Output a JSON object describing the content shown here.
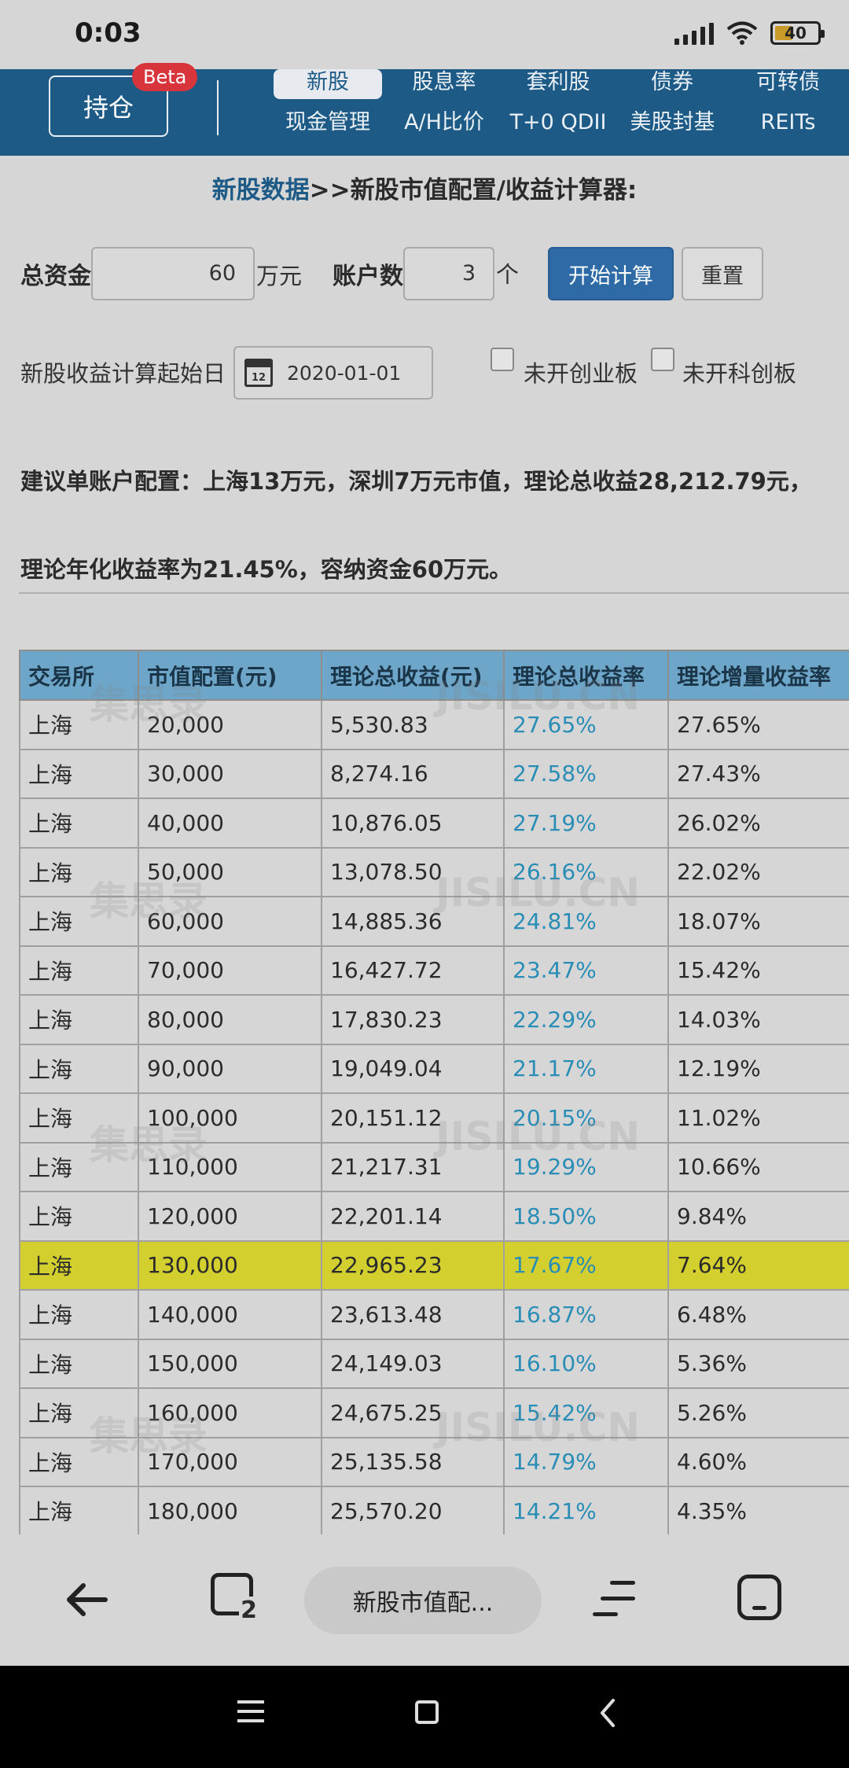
{
  "status": {
    "time": "0:03",
    "battery": "40"
  },
  "nav": {
    "holdings": "持仓",
    "beta": "Beta",
    "row1": [
      "新股",
      "股息率",
      "套利股",
      "债券",
      "可转债"
    ],
    "row2": [
      "现金管理",
      "A/H比价",
      "T+0 QDII",
      "美股封基",
      "REITs"
    ]
  },
  "title": {
    "link": "新股数据",
    "rest": ">>新股市值配置/收益计算器:"
  },
  "form": {
    "capital_label": "总资金",
    "capital_value": "60",
    "capital_unit": "万元",
    "accounts_label": "账户数",
    "accounts_value": "3",
    "accounts_unit": "个",
    "calc_button": "开始计算",
    "reset_button": "重置",
    "start_date_label": "新股收益计算起始日",
    "start_date_value": "2020-01-01",
    "calendar_day": "12",
    "chinext_label": "未开创业板",
    "star_label": "未开科创板"
  },
  "suggestion": "建议单账户配置：上海13万元，深圳7万元市值，理论总收益28,212.79元，理论年化收益率为21.45%，容纳资金60万元。",
  "table": {
    "headers": [
      "交易所",
      "市值配置(元)",
      "理论总收益(元)",
      "理论总收益率",
      "理论增量收益率"
    ],
    "highlight_row": 11,
    "rows": [
      [
        "上海",
        "20,000",
        "5,530.83",
        "27.65%",
        "27.65%"
      ],
      [
        "上海",
        "30,000",
        "8,274.16",
        "27.58%",
        "27.43%"
      ],
      [
        "上海",
        "40,000",
        "10,876.05",
        "27.19%",
        "26.02%"
      ],
      [
        "上海",
        "50,000",
        "13,078.50",
        "26.16%",
        "22.02%"
      ],
      [
        "上海",
        "60,000",
        "14,885.36",
        "24.81%",
        "18.07%"
      ],
      [
        "上海",
        "70,000",
        "16,427.72",
        "23.47%",
        "15.42%"
      ],
      [
        "上海",
        "80,000",
        "17,830.23",
        "22.29%",
        "14.03%"
      ],
      [
        "上海",
        "90,000",
        "19,049.04",
        "21.17%",
        "12.19%"
      ],
      [
        "上海",
        "100,000",
        "20,151.12",
        "20.15%",
        "11.02%"
      ],
      [
        "上海",
        "110,000",
        "21,217.31",
        "19.29%",
        "10.66%"
      ],
      [
        "上海",
        "120,000",
        "22,201.14",
        "18.50%",
        "9.84%"
      ],
      [
        "上海",
        "130,000",
        "22,965.23",
        "17.67%",
        "7.64%"
      ],
      [
        "上海",
        "140,000",
        "23,613.48",
        "16.87%",
        "6.48%"
      ],
      [
        "上海",
        "150,000",
        "24,149.03",
        "16.10%",
        "5.36%"
      ],
      [
        "上海",
        "160,000",
        "24,675.25",
        "15.42%",
        "5.26%"
      ],
      [
        "上海",
        "170,000",
        "25,135.58",
        "14.79%",
        "4.60%"
      ],
      [
        "上海",
        "180,000",
        "25,570.20",
        "14.21%",
        "4.35%"
      ]
    ]
  },
  "watermark": {
    "cn": "集思录",
    "en": "JISILU.CN"
  },
  "browser": {
    "tab_count": "2",
    "url_title": "新股市值配..."
  },
  "colors": {
    "nav_bg": "#1d5a86",
    "table_header": "#6ea6c9",
    "highlight": "#d2cf2e",
    "rate_text": "#2a8db5",
    "primary_button": "#2e6aa5"
  }
}
